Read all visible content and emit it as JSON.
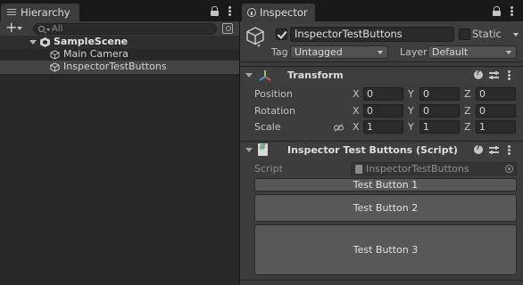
{
  "hierarchy": {
    "tab_label": "Hierarchy",
    "search_placeholder": "All",
    "scene_name": "SampleScene",
    "objects": [
      {
        "label": "Main Camera"
      },
      {
        "label": "InspectorTestButtons"
      }
    ],
    "add_label": "+"
  },
  "inspector": {
    "tab_label": "Inspector",
    "object_name": "InspectorTestButtons",
    "active_checked": true,
    "static_label": "Static",
    "tag_label": "Tag",
    "tag_value": "Untagged",
    "layer_label": "Layer",
    "layer_value": "Default",
    "transform": {
      "title": "Transform",
      "rows": [
        {
          "label": "Position",
          "x": "0",
          "y": "0",
          "z": "0"
        },
        {
          "label": "Rotation",
          "x": "0",
          "y": "0",
          "z": "0"
        },
        {
          "label": "Scale",
          "x": "1",
          "y": "1",
          "z": "1"
        }
      ],
      "axes": [
        "X",
        "Y",
        "Z"
      ]
    },
    "script_component": {
      "title": "Inspector Test Buttons (Script)",
      "script_label": "Script",
      "script_value": "InspectorTestButtons",
      "buttons": [
        "Test Button 1",
        "Test Button 2",
        "Test Button 3"
      ]
    }
  },
  "colors": {
    "panel": "#3c3c3c",
    "hierarchy_bg": "#282828",
    "selection": "#444444",
    "button": "#585858"
  }
}
